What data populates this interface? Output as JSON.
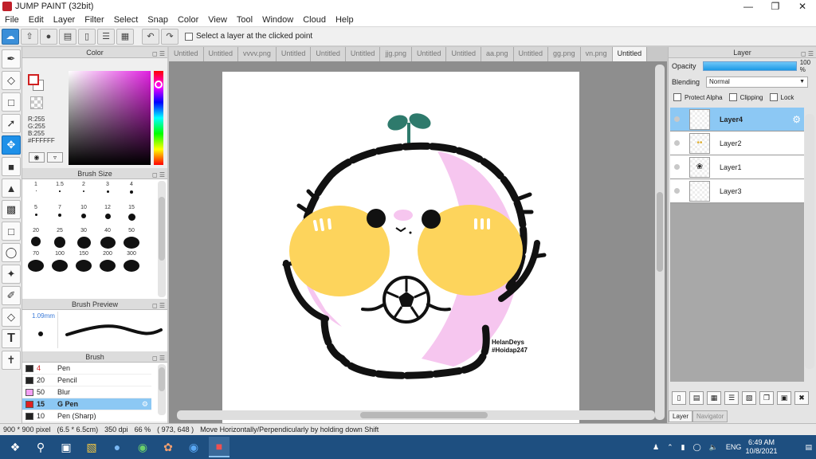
{
  "window": {
    "title": "JUMP PAINT (32bit)"
  },
  "menu": [
    "File",
    "Edit",
    "Layer",
    "Filter",
    "Select",
    "Snap",
    "Color",
    "View",
    "Tool",
    "Window",
    "Cloud",
    "Help"
  ],
  "toolbar": {
    "select_layer_label": "Select a layer at the clicked point"
  },
  "color_panel": {
    "title": "Color",
    "r": "R:255",
    "g": "G:255",
    "b": "B:255",
    "hex": "#FFFFFF",
    "fg": "#d02020",
    "sv_hue": "#e020e0"
  },
  "brush_size_panel": {
    "title": "Brush Size",
    "sizes": [
      "1",
      "1.5",
      "2",
      "3",
      "4",
      "5",
      "7",
      "10",
      "12",
      "15",
      "20",
      "25",
      "30",
      "40",
      "50",
      "70",
      "100",
      "150",
      "200",
      "300"
    ]
  },
  "brush_preview_panel": {
    "title": "Brush Preview",
    "size": "1.09mm"
  },
  "brush_panel": {
    "title": "Brush",
    "items": [
      {
        "size": "4",
        "name": "Pen",
        "color": "#222222"
      },
      {
        "size": "20",
        "name": "Pencil",
        "color": "#222222"
      },
      {
        "size": "50",
        "name": "Blur",
        "color": "#f4a0f4"
      },
      {
        "size": "15",
        "name": "G Pen",
        "color": "#e02020",
        "selected": true
      },
      {
        "size": "10",
        "name": "Pen (Sharp)",
        "color": "#222222"
      }
    ]
  },
  "tabs": [
    "Untitled",
    "Untitled",
    "vvvv.png",
    "Untitled",
    "Untitled",
    "Untitled",
    "jjg.png",
    "Untitled",
    "Untitled",
    "aa.png",
    "Untitled",
    "gg.png",
    "vn.png",
    "Untitled"
  ],
  "canvas": {
    "signature_line1": "HelanDeys",
    "signature_line2": "#Hoidap247"
  },
  "layer_panel": {
    "title": "Layer",
    "opacity_label": "Opacity",
    "opacity_value": "100 %",
    "opacity_fraction": 1.0,
    "blending_label": "Blending",
    "blending_value": "Normal",
    "protect_alpha": "Protect Alpha",
    "clipping": "Clipping",
    "lock": "Lock",
    "layers": [
      {
        "name": "Layer4",
        "selected": true
      },
      {
        "name": "Layer2"
      },
      {
        "name": "Layer1"
      },
      {
        "name": "Layer3"
      }
    ],
    "tab_layer": "Layer",
    "tab_navigator": "Navigator"
  },
  "status": {
    "size": "900 * 900 pixel",
    "size_cm": "(6.5 * 6.5cm)",
    "dpi": "350 dpi",
    "zoom": "66 %",
    "coords": "( 973, 648 )",
    "hint": "Move Horizontally/Perpendicularly by holding down Shift"
  },
  "taskbar": {
    "lang": "ENG",
    "time": "6:49 AM",
    "date": "10/8/2021"
  }
}
